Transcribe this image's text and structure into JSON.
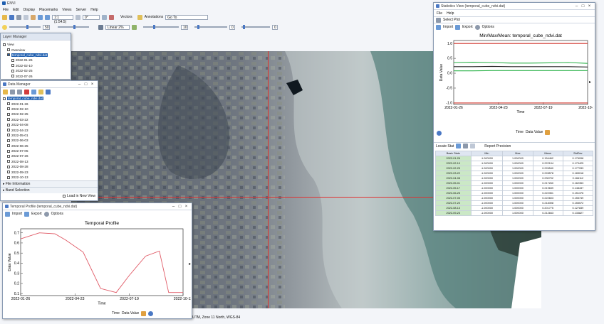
{
  "app": {
    "title": "ENVI",
    "menu": [
      "File",
      "Edit",
      "Display",
      "Placemarks",
      "Views",
      "Server",
      "Help"
    ],
    "zoom_combo": "1:1 (1:54.5)",
    "rotation_combo": "0°",
    "vectors_label": "Vectors",
    "annotations_label": "Annotations",
    "goto_label": "Go To",
    "stretch_combo": "Linear 2%",
    "brightness_value": "50",
    "contrast_value": "10",
    "sharpen_value": "0",
    "transparency_value": "0",
    "status_text": "UTM, Zone 11 North, WGS-84"
  },
  "layer_manager": {
    "title": "Layer Manager",
    "items": [
      "View",
      "Overview",
      "temporal_cube_ndvi.dat",
      "2022-01-26",
      "2022-02-10",
      "2022-02-25",
      "2022-07-26"
    ]
  },
  "data_manager": {
    "title": "Data Manager",
    "file": "temporal_cube_ndvi.dat",
    "bands": [
      "2022-01-26",
      "2022-02-10",
      "2022-02-25",
      "2022-03-22",
      "2022-04-08",
      "2022-04-23",
      "2022-05-01",
      "2022-06-03",
      "2022-06-25",
      "2022-07-05",
      "2022-07-26",
      "2022-08-13",
      "2022-08-28",
      "2022-09-23",
      "2022-10-13"
    ],
    "file_information": "File Information",
    "band_selection": "Band Selection",
    "load_in_new_view": "Load in New View"
  },
  "temporal_profile": {
    "title": "Temporal Profile (temporal_cube_ndvi.dat)",
    "import_label": "Import",
    "export_label": "Export",
    "options_label": "Options",
    "x_combo": "Time",
    "y_combo": "Data Value"
  },
  "statistics_view": {
    "title": "Statistics View (temporal_cube_ndvi.dat)",
    "menu": [
      "File",
      "Help"
    ],
    "select_plot": "Select Plot",
    "import_label": "Import",
    "export_label": "Export",
    "options_label": "Options",
    "x_combo": "Time",
    "y_combo": "Data Value",
    "locate_stat": "Locate Stat",
    "report_precision": "Report Precision",
    "table": {
      "headers": [
        "Basic Stats",
        "Min",
        "Max",
        "Mean",
        "StdDev"
      ],
      "rows": [
        [
          "2022-01-26",
          "-1.000000",
          "1.000000",
          "0.154462",
          "0.176098"
        ],
        [
          "2022-02-10",
          "-1.000000",
          "1.000000",
          "0.222194",
          "0.179425"
        ],
        [
          "2022-02-25",
          "-1.000000",
          "1.000000",
          "0.226540",
          "0.177933"
        ],
        [
          "2022-03-22",
          "-1.000000",
          "1.000000",
          "0.228578",
          "0.183018"
        ],
        [
          "2022-04-08",
          "-1.000000",
          "1.000000",
          "0.230702",
          "0.166112"
        ],
        [
          "2022-05-01",
          "-1.000000",
          "1.000000",
          "0.217260",
          "0.162353"
        ],
        [
          "2022-05-17",
          "-1.000000",
          "1.000000",
          "0.219639",
          "0.148437"
        ],
        [
          "2022-06-25",
          "-1.000000",
          "1.000000",
          "0.222351",
          "0.151376"
        ],
        [
          "2022-07-05",
          "-1.000000",
          "1.000000",
          "0.222603",
          "0.155749"
        ],
        [
          "2022-07-20",
          "-1.000000",
          "1.000000",
          "0.218398",
          "0.155572"
        ],
        [
          "2022-08-13",
          "-1.000000",
          "1.000000",
          "0.201775",
          "0.127839"
        ],
        [
          "2022-09-23",
          "-1.000000",
          "1.000000",
          "0.212843",
          "0.133827"
        ]
      ]
    }
  },
  "chart_data": [
    {
      "type": "line",
      "title": "Temporal Profile",
      "xlabel": "Time",
      "ylabel": "Data Value",
      "x": [
        "2022-01-26",
        "2022-02-25",
        "2022-03-22",
        "2022-04-08",
        "2022-05-06",
        "2022-06-03",
        "2022-06-28",
        "2022-07-19",
        "2022-08-14",
        "2022-09-05",
        "2022-09-20",
        "2022-10-13"
      ],
      "x_ticks": [
        "2022-01-26",
        "2022-04-23",
        "2022-07-19",
        "2022-10-13"
      ],
      "y_ticks": [
        "0.1",
        "0.2",
        "0.3",
        "0.4",
        "0.5",
        "0.6",
        "0.7"
      ],
      "xlim": [
        "2022-01-26",
        "2022-10-13"
      ],
      "ylim": [
        0.08,
        0.74
      ],
      "series": [
        {
          "values": [
            0.64,
            0.7,
            0.69,
            0.63,
            0.51,
            0.15,
            0.11,
            0.28,
            0.47,
            0.52,
            0.11,
            0.11
          ],
          "color": "#e05a66"
        }
      ],
      "grid": false
    },
    {
      "type": "line",
      "title": "Min/Max/Mean: temporal_cube_ndvi.dat",
      "xlabel": "Time",
      "ylabel": "Data Value",
      "x_ticks": [
        "2022-01-26",
        "2022-04-23",
        "2022-07-19",
        "2022-10-13"
      ],
      "y_ticks": [
        "-1.0",
        "-0.5",
        "0.0",
        "0.5",
        "1.0"
      ],
      "xlim": [
        "2022-01-26",
        "2022-10-13"
      ],
      "ylim": [
        -1.05,
        1.1
      ],
      "series": [
        {
          "values": [
            1.0,
            1.0,
            1.0,
            1.0,
            1.0,
            1.0,
            1.0,
            1.0
          ],
          "color": "#d0342c"
        },
        {
          "values": [
            -1.0,
            -1.0,
            -1.0,
            -1.0,
            -1.0,
            -1.0,
            -1.0,
            -1.0
          ],
          "color": "#d0342c"
        },
        {
          "values": [
            0.36,
            0.37,
            0.36,
            0.34,
            0.34,
            0.35,
            0.36,
            0.33
          ],
          "color": "#2db34a"
        },
        {
          "values": [
            0.22,
            0.22,
            0.23,
            0.22,
            0.22,
            0.22,
            0.22,
            0.21
          ],
          "color": "#222222"
        },
        {
          "values": [
            0.08,
            0.08,
            0.09,
            0.09,
            0.09,
            0.09,
            0.09,
            0.09
          ],
          "color": "#2db34a"
        }
      ],
      "grid": false
    }
  ]
}
